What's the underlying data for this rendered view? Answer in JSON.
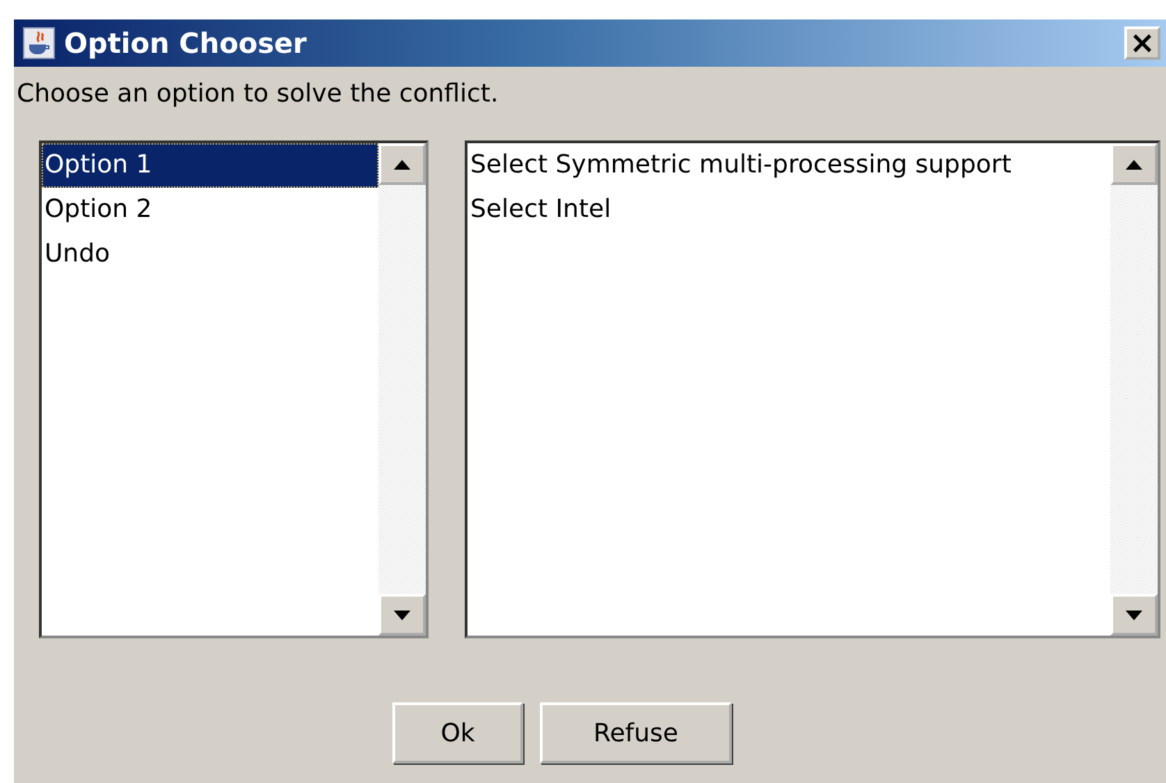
{
  "window": {
    "title": "Option Chooser",
    "close": "×"
  },
  "prompt": "Choose an option to solve the conflict.",
  "options": [
    {
      "label": "Option 1",
      "selected": true
    },
    {
      "label": "Option 2",
      "selected": false
    },
    {
      "label": "Undo",
      "selected": false
    }
  ],
  "actions": [
    "Select Symmetric multi-processing support",
    "Select Intel"
  ],
  "buttons": [
    "Ok",
    "Refuse"
  ]
}
